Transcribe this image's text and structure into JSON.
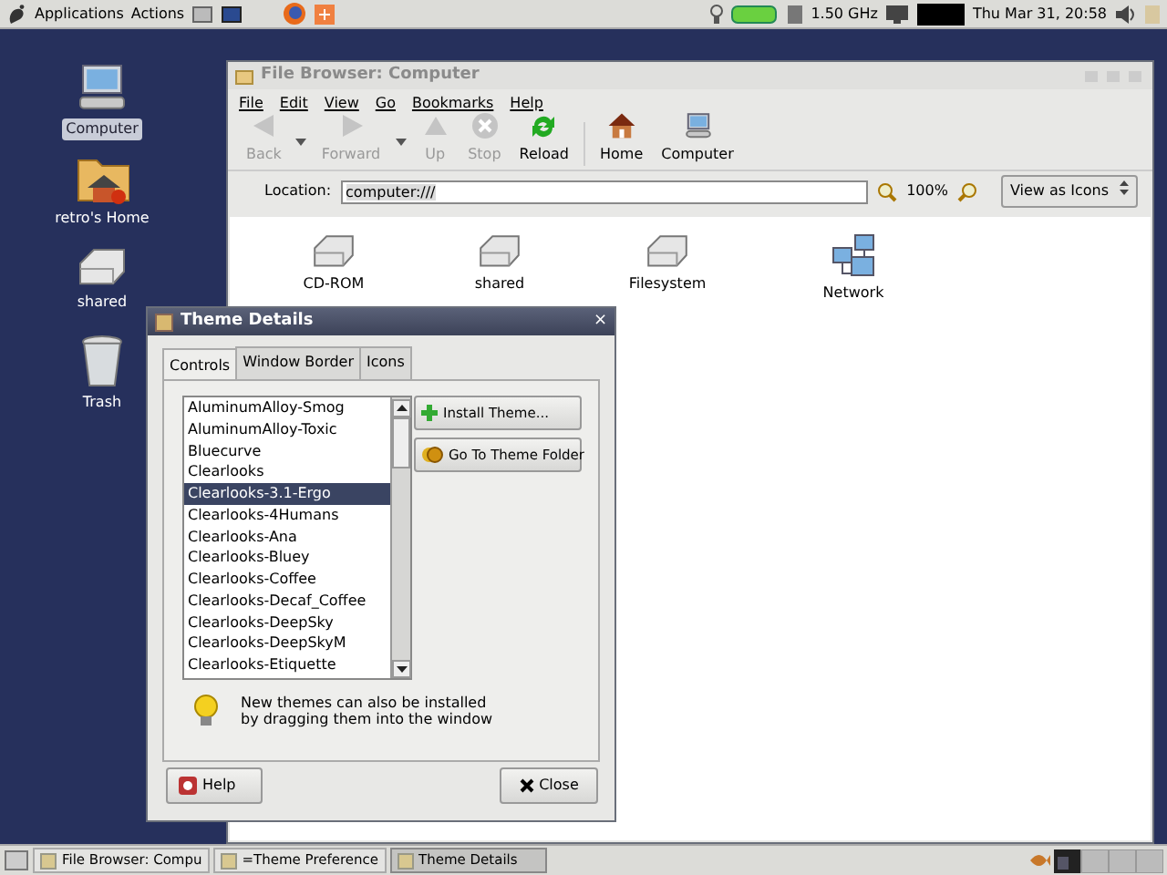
{
  "top_panel": {
    "menus": [
      "Applications",
      "Actions"
    ],
    "cpu_freq": "1.50 GHz",
    "clock": "Thu Mar 31, 20:58"
  },
  "desktop_icons": [
    {
      "label": "Computer",
      "kind": "computer",
      "selected": true
    },
    {
      "label": "retro's Home",
      "kind": "home",
      "selected": false
    },
    {
      "label": "shared",
      "kind": "drive",
      "selected": false
    },
    {
      "label": "Trash",
      "kind": "trash",
      "selected": false
    }
  ],
  "file_browser": {
    "title": "File Browser: Computer",
    "menu": [
      "File",
      "Edit",
      "View",
      "Go",
      "Bookmarks",
      "Help"
    ],
    "toolbar": [
      {
        "label": "Back",
        "kind": "back",
        "disabled": true
      },
      {
        "label": "Forward",
        "kind": "forward",
        "disabled": true
      },
      {
        "label": "Up",
        "kind": "up",
        "disabled": true
      },
      {
        "label": "Stop",
        "kind": "stop",
        "disabled": true
      },
      {
        "label": "Reload",
        "kind": "reload",
        "disabled": false
      },
      {
        "label": "Home",
        "kind": "home",
        "disabled": false
      },
      {
        "label": "Computer",
        "kind": "computer",
        "disabled": false
      }
    ],
    "location_label": "Location:",
    "location": "computer:///",
    "zoom": "100%",
    "view_mode": "View as Icons",
    "items": [
      {
        "label": "CD-ROM",
        "kind": "drive"
      },
      {
        "label": "shared",
        "kind": "drive"
      },
      {
        "label": "Filesystem",
        "kind": "drive"
      },
      {
        "label": "Network",
        "kind": "network"
      }
    ]
  },
  "theme_dialog": {
    "title": "Theme Details",
    "close_glyph": "×",
    "tabs": [
      {
        "label": "Controls",
        "selected": true
      },
      {
        "label": "Window Border",
        "selected": false
      },
      {
        "label": "Icons",
        "selected": false
      }
    ],
    "themes": [
      {
        "name": "AluminumAlloy-Smog",
        "selected": false
      },
      {
        "name": "AluminumAlloy-Toxic",
        "selected": false
      },
      {
        "name": "Bluecurve",
        "selected": false
      },
      {
        "name": "Clearlooks",
        "selected": false
      },
      {
        "name": "Clearlooks-3.1-Ergo",
        "selected": true
      },
      {
        "name": "Clearlooks-4Humans",
        "selected": false
      },
      {
        "name": "Clearlooks-Ana",
        "selected": false
      },
      {
        "name": "Clearlooks-Bluey",
        "selected": false
      },
      {
        "name": "Clearlooks-Coffee",
        "selected": false
      },
      {
        "name": "Clearlooks-Decaf_Coffee",
        "selected": false
      },
      {
        "name": "Clearlooks-DeepSky",
        "selected": false
      },
      {
        "name": "Clearlooks-DeepSkyM",
        "selected": false
      },
      {
        "name": "Clearlooks-Etiquette",
        "selected": false
      }
    ],
    "actions": [
      {
        "label": "Install Theme...",
        "kind": "install"
      },
      {
        "label": "Go To Theme Folder",
        "kind": "folder"
      }
    ],
    "hint_lines": [
      "New themes can also be installed",
      "by dragging them into the window"
    ],
    "help": "Help",
    "close": "Close"
  },
  "taskbar": [
    {
      "label": "File Browser: Compu",
      "selected": false
    },
    {
      "label": "=Theme Preference",
      "selected": false
    },
    {
      "label": "Theme Details",
      "selected": true
    }
  ]
}
